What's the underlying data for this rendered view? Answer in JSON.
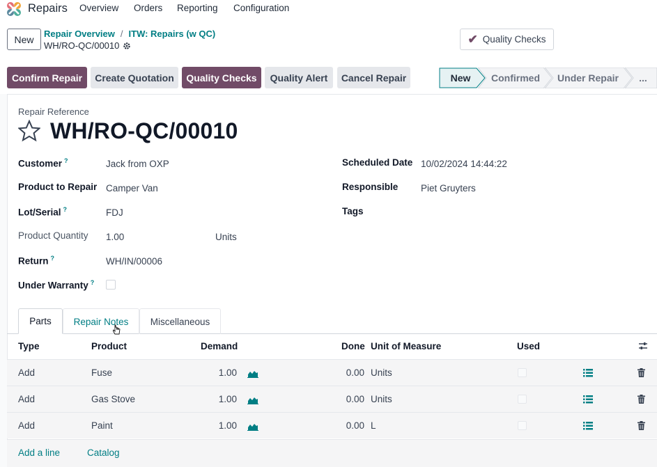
{
  "navbar": {
    "app_name": "Repairs",
    "menu": [
      "Overview",
      "Orders",
      "Reporting",
      "Configuration"
    ]
  },
  "control_panel": {
    "new_label": "New",
    "breadcrumb": [
      "Repair Overview",
      "ITW: Repairs (w QC)"
    ],
    "record_name": "WH/RO-QC/00010",
    "smart_button": "Quality Checks"
  },
  "actions": {
    "confirm": "Confirm Repair",
    "create_quotation": "Create Quotation",
    "quality_checks": "Quality Checks",
    "quality_alert": "Quality Alert",
    "cancel": "Cancel Repair"
  },
  "statusbar": {
    "stages": [
      "New",
      "Confirmed",
      "Under Repair",
      "..."
    ],
    "active": "New"
  },
  "form": {
    "ref_label": "Repair Reference",
    "title": "WH/RO-QC/00010",
    "left": {
      "customer_label": "Customer",
      "customer_value": "Jack from OXP",
      "product_label": "Product to Repair",
      "product_value": "Camper Van",
      "lot_label": "Lot/Serial",
      "lot_value": "FDJ",
      "qty_label": "Product Quantity",
      "qty_value": "1.00",
      "qty_uom": "Units",
      "return_label": "Return",
      "return_value": "WH/IN/00006",
      "warranty_label": "Under Warranty"
    },
    "right": {
      "scheduled_label": "Scheduled Date",
      "scheduled_value": "10/02/2024 14:44:22",
      "responsible_label": "Responsible",
      "responsible_value": "Piet Gruyters",
      "tags_label": "Tags"
    },
    "help_mark": "?"
  },
  "tabs": [
    "Parts",
    "Repair Notes",
    "Miscellaneous"
  ],
  "table": {
    "headers": {
      "type": "Type",
      "product": "Product",
      "demand": "Demand",
      "done": "Done",
      "uom": "Unit of Measure",
      "used": "Used"
    },
    "rows": [
      {
        "type": "Add",
        "product": "Fuse",
        "demand": "1.00",
        "done": "0.00",
        "uom": "Units"
      },
      {
        "type": "Add",
        "product": "Gas Stove",
        "demand": "1.00",
        "done": "0.00",
        "uom": "Units"
      },
      {
        "type": "Add",
        "product": "Paint",
        "demand": "1.00",
        "done": "0.00",
        "uom": "L"
      }
    ],
    "add_line": "Add a line",
    "catalog": "Catalog"
  },
  "colors": {
    "primary": "#714b67",
    "link": "#017e84"
  }
}
